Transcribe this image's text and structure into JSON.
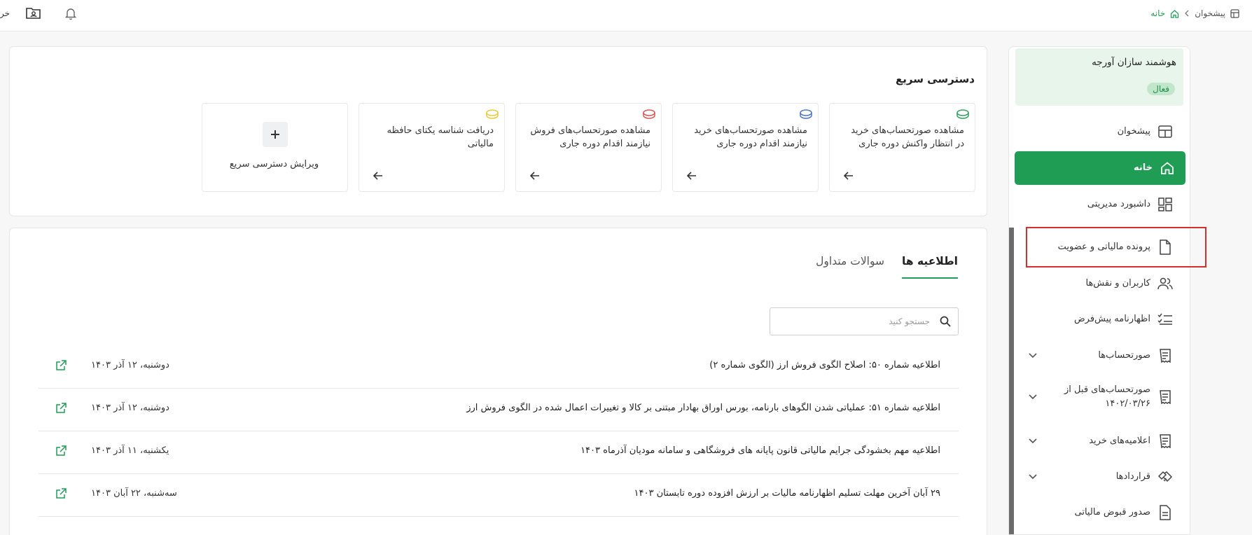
{
  "topbar": {
    "breadcrumb": {
      "root": "پیشخوان",
      "current": "خانه"
    },
    "left_clipped_text": "خروج",
    "icons": [
      "folder-user-icon",
      "bell-icon"
    ]
  },
  "sidebar": {
    "company": {
      "name": "هوشمند سازان آورجه",
      "status": "فعال"
    },
    "items": [
      {
        "label": "پیشخوان",
        "icon": "dashboard-grid-icon"
      },
      {
        "label": "خانه",
        "icon": "home-icon",
        "active": true
      },
      {
        "label": "داشبورد مدیریتی",
        "icon": "widgets-icon"
      },
      {
        "label": "پرونده مالیاتی و عضویت",
        "icon": "document-icon",
        "highlighted": true
      },
      {
        "label": "کاربران و نقش‌ها",
        "icon": "users-icon"
      },
      {
        "label": "اظهارنامه پیش‌فرض",
        "icon": "checklist-icon"
      },
      {
        "label": "صورتحساب‌ها",
        "icon": "receipt-icon",
        "expandable": true
      },
      {
        "label": "صورتحساب‌های قبل از ۱۴۰۲/۰۳/۲۶",
        "icon": "receipt-icon",
        "expandable": true
      },
      {
        "label": "اعلامیه‌های خرید",
        "icon": "receipt-icon",
        "expandable": true
      },
      {
        "label": "قراردادها",
        "icon": "handshake-icon",
        "expandable": true
      },
      {
        "label": "صدور قبوض مالیاتی",
        "icon": "bill-icon"
      }
    ]
  },
  "quick_access": {
    "title": "دسترسی سریع",
    "tiles": [
      {
        "text": "مشاهده صورتحساب‌های خرید در انتظار واکنش دوره جاری",
        "icon_color": "#2e9e5b"
      },
      {
        "text": "مشاهده صورتحساب‌های خرید نیازمند اقدام دوره جاری",
        "icon_color": "#4a72c4"
      },
      {
        "text": "مشاهده صورتحساب‌های فروش نیازمند اقدام دوره جاری",
        "icon_color": "#d9534f"
      },
      {
        "text": "دریافت شناسه یکتای حافظه مالیاتی",
        "icon_color": "#e8c93a"
      }
    ],
    "edit_label": "ویرایش دسترسی سریع"
  },
  "news": {
    "tabs": [
      "اطلاعیه ها",
      "سوالات متداول"
    ],
    "active_tab": 0,
    "search_placeholder": "جستجو کنید",
    "rows": [
      {
        "title": "اطلاعیه شماره ۵۰: اصلاح الگوی فروش ارز (الگوی شماره ۲)",
        "date": "دوشنبه، ۱۲ آذر ۱۴۰۳"
      },
      {
        "title": "اطلاعیه شماره ۵۱: عملیاتی شدن الگوهای بارنامه، بورس اوراق بهادار مبتنی بر کالا و تغییرات اعمال شده در الگوی فروش ارز",
        "date": "دوشنبه، ۱۲ آذر ۱۴۰۳"
      },
      {
        "title": "اطلاعیه مهم بخشودگی جرایم مالیاتی قانون پایانه های فروشگاهی و سامانه مودیان آذرماه ۱۴۰۳",
        "date": "یکشنبه، ۱۱ آذر ۱۴۰۳"
      },
      {
        "title": "۲۹ آبان آخرین مهلت تسلیم اظهارنامه مالیات بر ارزش افزوده دوره تابستان ۱۴۰۳",
        "date": "سه‌شنبه، ۲۲ آبان ۱۴۰۳"
      }
    ]
  },
  "colors": {
    "accent": "#1f9d55",
    "highlight_box": "#d32f2f"
  }
}
